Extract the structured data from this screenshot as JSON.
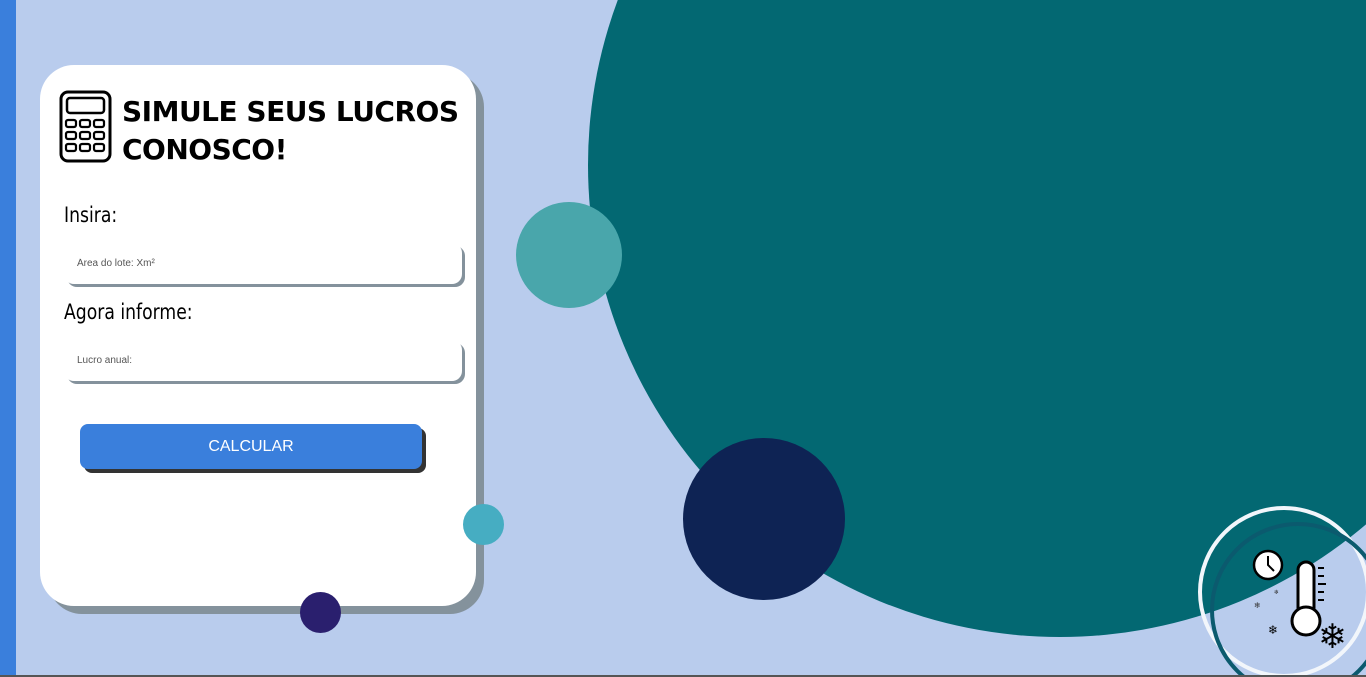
{
  "card": {
    "title_line1": "SIMULE SEUS LUCROS",
    "title_line2": "CONOSCO!",
    "label_area": "Insira:",
    "placeholder_area": "Área do lote: Xm²",
    "label_profit": "Agora informe:",
    "placeholder_profit": "Lucro anual:",
    "button_label": "CALCULAR"
  },
  "colors": {
    "accent": "#3a7fdc",
    "background": "#b9cced",
    "teal": "#036872",
    "navy": "#0e2354"
  }
}
